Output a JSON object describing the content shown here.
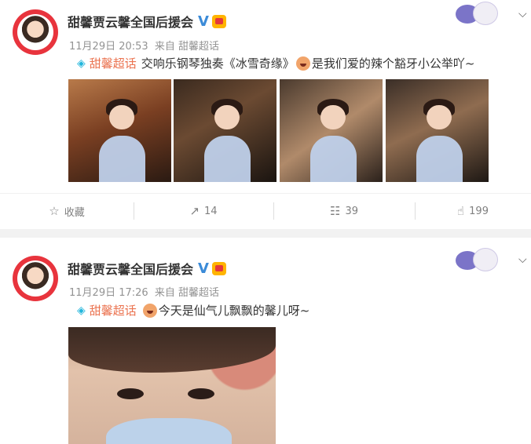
{
  "posts": [
    {
      "author": "甜馨贾云馨全国后援会",
      "verified": "V",
      "time": "11月29日 20:53",
      "source": "来自 甜馨超话",
      "topic": "甜馨超话",
      "text_before_emoji": "交响乐钢琴独奏《冰雪奇缘》",
      "text_after_emoji": "是我们爱的辣个豁牙小公举吖~",
      "photo_count": 4,
      "actions": {
        "favorite": "收藏",
        "repost": "14",
        "comment": "39",
        "like": "199"
      }
    },
    {
      "author": "甜馨贾云馨全国后援会",
      "verified": "V",
      "time": "11月29日 17:26",
      "source": "来自 甜馨超话",
      "topic": "甜馨超话",
      "text_after_emoji": "今天是仙气儿飘飘的馨儿呀~",
      "photo_count": 1
    }
  ],
  "icons": {
    "topic": "topic-diamond-icon",
    "chevron": "chevron-down-icon",
    "favorite": "star-icon",
    "repost": "repost-icon",
    "comment": "comment-icon",
    "like": "thumbs-up-icon"
  },
  "colors": {
    "topic": "#eb7350",
    "topic_icon": "#22b6dc",
    "verified": "#3b8bd8",
    "meta": "#939393",
    "avatar_ring": "#e8343d"
  }
}
